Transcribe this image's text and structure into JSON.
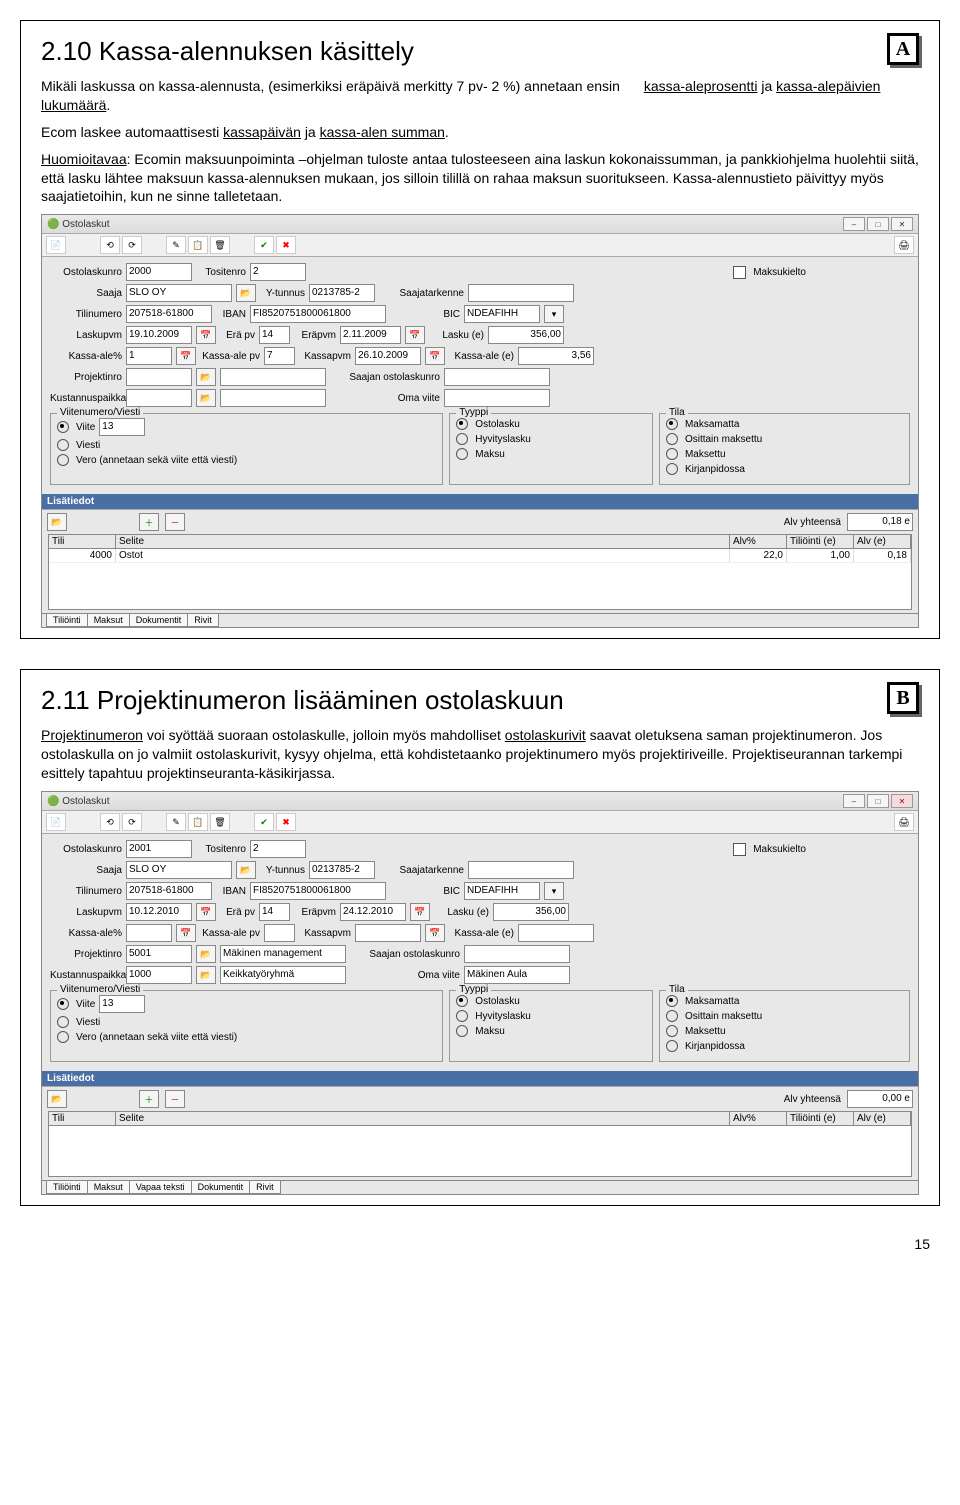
{
  "page_number": "15",
  "sectionA": {
    "badge": "A",
    "title": "2.10 Kassa-alennuksen käsittely",
    "para1_prefix": "Mikäli laskussa on kassa-alennusta, (esimerkiksi eräpäivä merkitty 7 pv- 2 %) annetaan ensin ",
    "para1_u1": "kassa-aleprosentti",
    "para1_mid": " ja ",
    "para1_u2": "kassa-alepäivien lukumäärä",
    "para1_end": ".",
    "para2_prefix": "Ecom laskee automaattisesti ",
    "para2_u1": "kassapäivän",
    "para2_mid": " ja ",
    "para2_u2": "kassa-alen summan",
    "para2_end": ".",
    "para3_u": "Huomioitavaa",
    "para3_body": ": Ecomin maksuunpoiminta –ohjelman tuloste antaa tulosteeseen aina laskun kokonaissumman, ja pankkiohjelma huolehtii siitä, että lasku lähtee maksuun kassa-alennuksen mukaan, jos silloin tilillä on rahaa maksun suoritukseen. Kassa-alennustieto päivittyy myös saajatietoihin, kun ne sinne talletetaan.",
    "window": {
      "title": "Ostolaskut",
      "labels": {
        "ostolaskunro": "Ostolaskunro",
        "tositenro": "Tositenro",
        "maksukielto": "Maksukielto",
        "saaja": "Saaja",
        "ytunnus": "Y-tunnus",
        "saajatarkenne": "Saajatarkenne",
        "tilinumero": "Tilinumero",
        "iban": "IBAN",
        "bic": "BIC",
        "laskupvm": "Laskupvm",
        "erapv": "Erä pv",
        "erapvm": "Eräpvm",
        "laskue": "Lasku (e)",
        "kassaale": "Kassa-ale%",
        "kassaalepv": "Kassa-ale pv",
        "kassapvm": "Kassapvm",
        "kassaalee": "Kassa-ale (e)",
        "projektinro": "Projektinro",
        "saajan_ostolaskunro": "Saajan ostolaskunro",
        "kustannuspaikka": "Kustannuspaikka",
        "omaviite": "Oma viite",
        "viitenumero_viesti": "Viitenumero/Viesti",
        "viite": "Viite",
        "viesti": "Viesti",
        "vero": "Vero (annetaan sekä viite että viesti)",
        "tyyppi": "Tyyppi",
        "tila": "Tila",
        "ostolasku": "Ostolasku",
        "hyvityslasku": "Hyvityslasku",
        "maksu": "Maksu",
        "maksamatta": "Maksamatta",
        "osittain": "Osittain maksettu",
        "maksettu": "Maksettu",
        "kirjanpidossa": "Kirjanpidossa",
        "lisatiedot": "Lisätiedot",
        "alvyhteensa": "Alv yhteensä",
        "tili": "Tili",
        "selite": "Selite",
        "alvp": "Alv%",
        "tiliointi_e": "Tiliöinti (e)",
        "alv_e": "Alv (e)"
      },
      "vals": {
        "ostolaskunro": "2000",
        "tositenro": "2",
        "saaja": "SLO OY",
        "ytunnus": "0213785-2",
        "tilinumero": "207518-61800",
        "iban": "FI8520751800061800",
        "bic": "NDEAFIHH",
        "laskupvm": "19.10.2009",
        "erapv": "14",
        "erapvm": "2.11.2009",
        "laskue": "356,00",
        "kassaale": "1",
        "kassaalepv": "7",
        "kassapvm": "26.10.2009",
        "kassaalee": "3,56",
        "viite": "13",
        "alvyhteensa": "0,18 e",
        "row_tili": "4000",
        "row_selite": "Ostot",
        "row_alv": "22,0",
        "row_tilie": "1,00",
        "row_alve": "0,18"
      },
      "tabs": [
        "Tiliöinti",
        "Maksut",
        "Dokumentit",
        "Rivit"
      ]
    }
  },
  "sectionB": {
    "badge": "B",
    "title": "2.11 Projektinumeron lisääminen ostolaskuun",
    "para1_u1": "Projektinumeron",
    "para1_mid": " voi syöttää suoraan ostolaskulle, jolloin myös mahdolliset ",
    "para1_u2": "ostolaskurivit",
    "para1_end": " saavat oletuksena saman projektinumeron. Jos ostolaskulla on jo valmiit ostolaskurivit, kysyy ohjelma, että kohdistetaanko projektinumero myös projektiriveille. Projektiseurannan tarkempi esittely tapahtuu projektinseuranta-käsikirjassa.",
    "window": {
      "vals": {
        "ostolaskunro": "2001",
        "tositenro": "2",
        "saaja": "SLO OY",
        "ytunnus": "0213785-2",
        "tilinumero": "207518-61800",
        "iban": "FI8520751800061800",
        "bic": "NDEAFIHH",
        "laskupvm": "10.12.2010",
        "erapv": "14",
        "erapvm": "24.12.2010",
        "laskue": "356,00",
        "projektinro": "5001",
        "projektinimi": "Mäkinen management",
        "kustannuspaikka": "1000",
        "kustannusnimi": "Keikkatyöryhmä",
        "omaviite": "Mäkinen Aula",
        "viite": "13",
        "alvyhteensa": "0,00 e"
      },
      "tabs": [
        "Tiliöinti",
        "Maksut",
        "Vapaa teksti",
        "Dokumentit",
        "Rivit"
      ]
    }
  }
}
